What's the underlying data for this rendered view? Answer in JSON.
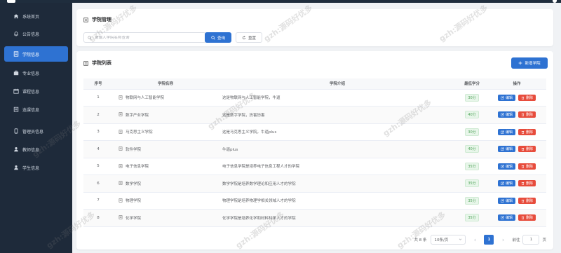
{
  "sidebar": {
    "items": [
      {
        "label": "系统首页",
        "icon": "home-icon",
        "active": false
      },
      {
        "label": "公告信息",
        "icon": "bell-icon",
        "active": false
      },
      {
        "label": "学院信息",
        "icon": "document-icon",
        "active": true
      },
      {
        "label": "专业信息",
        "icon": "briefcase-icon",
        "active": false
      },
      {
        "label": "课程信息",
        "icon": "calendar-icon",
        "active": false
      },
      {
        "label": "选课信息",
        "icon": "clipboard-icon",
        "active": false
      },
      {
        "label": "管理员信息",
        "icon": "phone-icon",
        "active": false
      },
      {
        "label": "教师信息",
        "icon": "user-icon",
        "active": false
      },
      {
        "label": "学生信息",
        "icon": "user-icon",
        "active": false
      }
    ]
  },
  "search": {
    "title": "学院管理",
    "placeholder": "请输入学院名称查询",
    "query_label": "查询",
    "reset_label": "重置"
  },
  "list": {
    "title": "学院列表",
    "add_label": "新增学院",
    "columns": [
      "序号",
      "学院名称",
      "学院介绍",
      "最低学分",
      "操作"
    ],
    "edit_label": "编辑",
    "delete_label": "删除",
    "rows": [
      {
        "no": "1",
        "name": "物联网与人工智能学院",
        "intro": "这是物联网与人工智能学院，牛逼",
        "credit": "30分"
      },
      {
        "no": "2",
        "name": "数字产业学院",
        "intro": "这是数字学院，历害历害",
        "credit": "40分"
      },
      {
        "no": "3",
        "name": "马克思主义学院",
        "intro": "这是马克思主义学院，牛逼plus",
        "credit": "30分"
      },
      {
        "no": "4",
        "name": "软件学院",
        "intro": "牛逼plus",
        "credit": "40分"
      },
      {
        "no": "5",
        "name": "电子信息学院",
        "intro": "电子信息学院是培养电子信息工程人才的学院",
        "credit": "35分"
      },
      {
        "no": "6",
        "name": "数学学院",
        "intro": "数学学院是培养数学理论和应用人才的学院",
        "credit": "35分"
      },
      {
        "no": "7",
        "name": "物理学院",
        "intro": "物理学院是培养物理学相关领域人才的学院",
        "credit": "35分"
      },
      {
        "no": "8",
        "name": "化学学院",
        "intro": "化学学院是培养化学和材料科学人才的学院",
        "credit": "35分"
      }
    ]
  },
  "pagination": {
    "total": "共 8 条",
    "page_size": "10条/页",
    "current": "1",
    "goto_label": "前往",
    "goto_value": "1",
    "page_unit": "页"
  },
  "watermark": "gzh:源码好优多",
  "colors": {
    "primary": "#2e72d2",
    "danger": "#e74c3c",
    "sidebar": "#1e2a3a"
  }
}
